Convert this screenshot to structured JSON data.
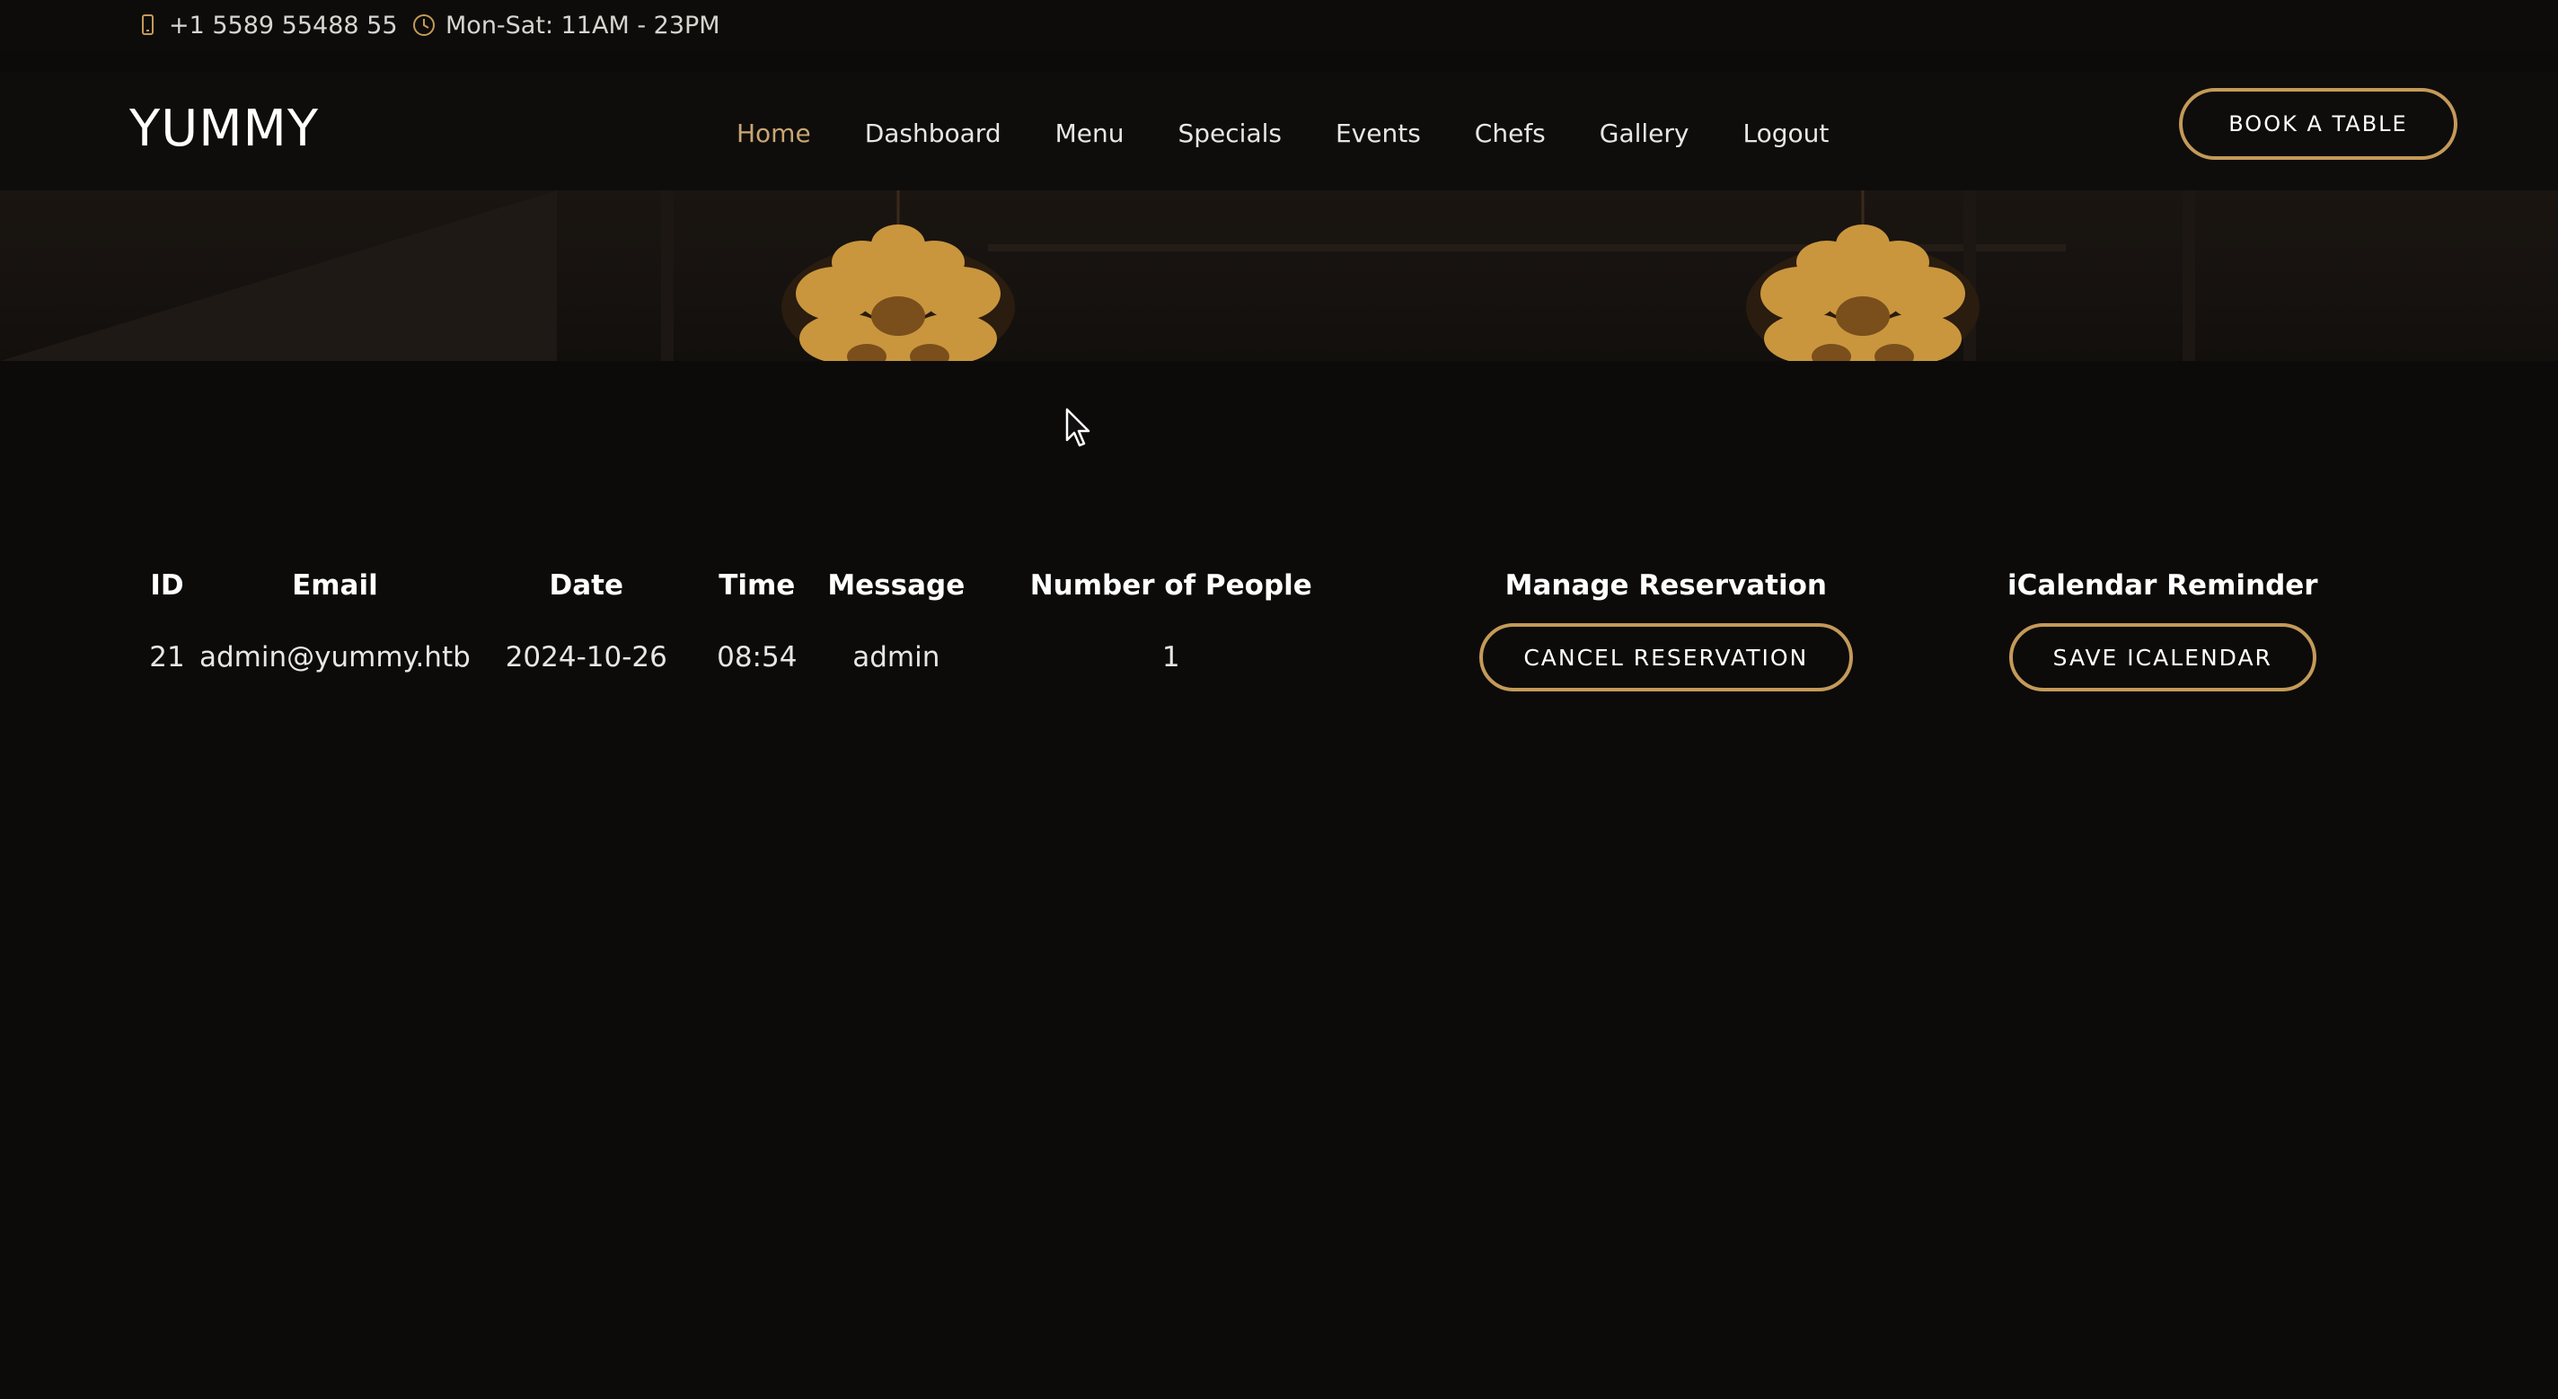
{
  "topbar": {
    "phone": "+1 5589 55488 55",
    "phone_icon": "phone-icon",
    "hours": "Mon-Sat: 11AM - 23PM",
    "hours_icon": "clock-icon"
  },
  "header": {
    "logo": "YUMMY",
    "nav": [
      "Home",
      "Dashboard",
      "Menu",
      "Specials",
      "Events",
      "Chefs",
      "Gallery",
      "Logout"
    ],
    "active_nav": "Home",
    "book_button": "BOOK A TABLE"
  },
  "colors": {
    "accent": "#c49a58",
    "active_link": "#c9a673",
    "background": "#0c0b0a"
  },
  "table": {
    "headers": {
      "id": "ID",
      "email": "Email",
      "date": "Date",
      "time": "Time",
      "message": "Message",
      "people": "Number of People",
      "manage": "Manage Reservation",
      "ical": "iCalendar Reminder"
    },
    "rows": [
      {
        "id": "21",
        "email": "admin@yummy.htb",
        "date": "2024-10-26",
        "time": "08:54",
        "message": "admin",
        "people": "1",
        "cancel_label": "CANCEL RESERVATION",
        "ical_label": "SAVE ICALENDAR"
      }
    ]
  }
}
